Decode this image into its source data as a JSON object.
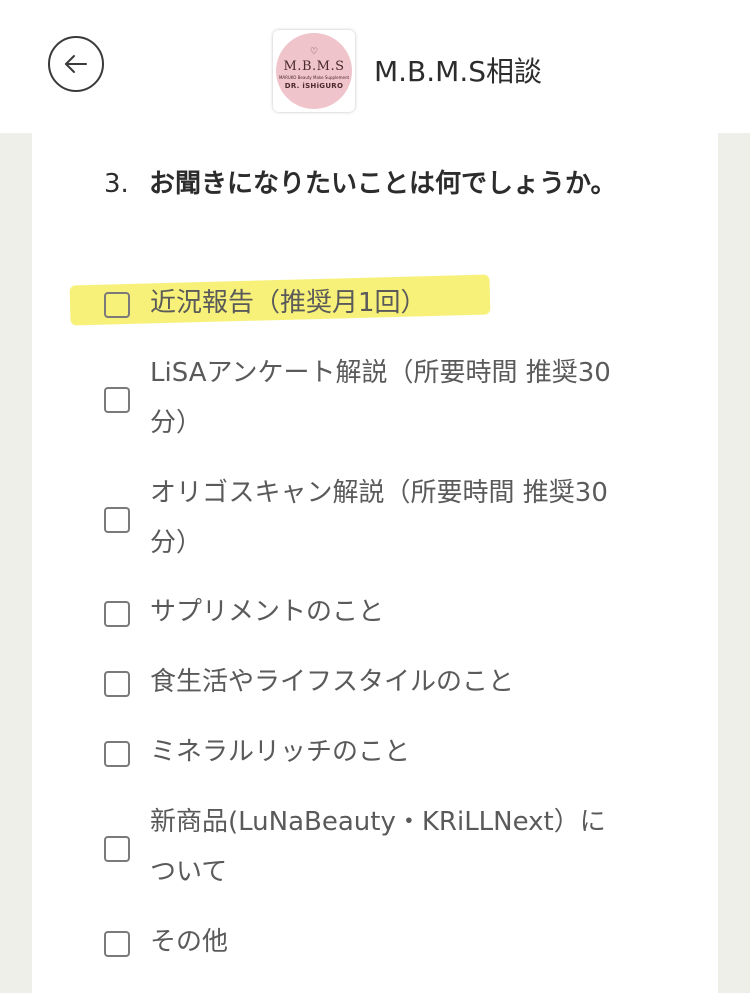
{
  "header": {
    "title": "M.B.M.S相談",
    "back_icon": "arrow-left-icon",
    "logo": {
      "mark": "♡",
      "title": "M.B.M.S",
      "subtitle": "MARUKO Beauty Make Supplement",
      "name": "DR. iSHiGURO",
      "color": "#f0c4cb"
    }
  },
  "question": {
    "number": "3.",
    "text": "お聞きになりたいことは何でしょうか。"
  },
  "highlight_color": "#f6f06a",
  "options": [
    {
      "label": "近況報告（推奨月1回）",
      "checked": false
    },
    {
      "label": "LiSAアンケート解説（所要時間 推奨30分）",
      "checked": false
    },
    {
      "label": "オリゴスキャン解説（所要時間 推奨30分）",
      "checked": false
    },
    {
      "label": "サプリメントのこと",
      "checked": false
    },
    {
      "label": "食生活やライフスタイルのこと",
      "checked": false
    },
    {
      "label": "ミネラルリッチのこと",
      "checked": false
    },
    {
      "label": "新商品(LuNaBeauty・KRiLLNext）について",
      "checked": false
    },
    {
      "label": "その他",
      "checked": false
    }
  ]
}
